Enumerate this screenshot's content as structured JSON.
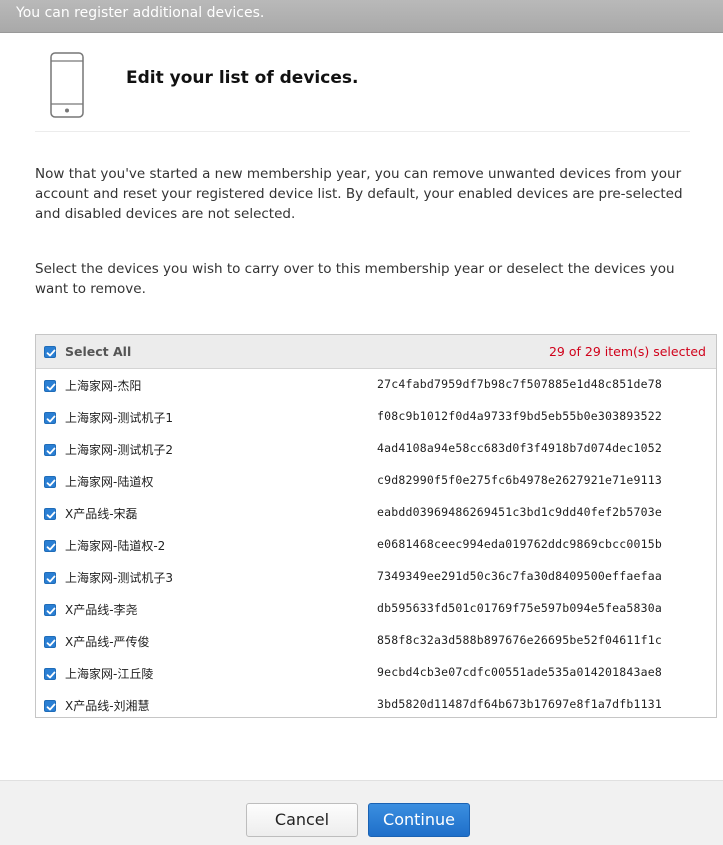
{
  "banner": {
    "text": "You can register additional devices."
  },
  "header": {
    "icon": "iphone-outline-icon",
    "title": "Edit your list of devices."
  },
  "intro": {
    "paragraph1": "Now that you've started a new membership year, you can remove unwanted devices from your account and reset your registered device list. By default, your enabled devices are pre-selected and disabled devices are not selected.",
    "paragraph2": "Select the devices you wish to carry over to this membership year or deselect the devices you want to remove."
  },
  "device_list": {
    "select_all_label": "Select All",
    "select_all_checked": true,
    "selection_count": "29 of 29 item(s) selected",
    "rows": [
      {
        "name": "上海家网-杰阳",
        "udid": "27c4fabd7959df7b98c7f507885e1d48c851de78",
        "checked": true
      },
      {
        "name": "上海家网-测试机子1",
        "udid": "f08c9b1012f0d4a9733f9bd5eb55b0e303893522",
        "checked": true
      },
      {
        "name": "上海家网-测试机子2",
        "udid": "4ad4108a94e58cc683d0f3f4918b7d074dec1052",
        "checked": true
      },
      {
        "name": "上海家网-陆道权",
        "udid": "c9d82990f5f0e275fc6b4978e2627921e71e9113",
        "checked": true
      },
      {
        "name": "X产品线-宋磊",
        "udid": "eabdd03969486269451c3bd1c9dd40fef2b5703e",
        "checked": true
      },
      {
        "name": "上海家网-陆道权-2",
        "udid": "e0681468ceec994eda019762ddc9869cbcc0015b",
        "checked": true
      },
      {
        "name": "上海家网-测试机子3",
        "udid": "7349349ee291d50c36c7fa30d8409500effaefaa",
        "checked": true
      },
      {
        "name": "X产品线-李尧",
        "udid": "db595633fd501c01769f75e597b094e5fea5830a",
        "checked": true
      },
      {
        "name": "X产品线-严传俊",
        "udid": "858f8c32a3d588b897676e26695be52f04611f1c",
        "checked": true
      },
      {
        "name": "上海家网-江丘陵",
        "udid": "9ecbd4cb3e07cdfc00551ade535a014201843ae8",
        "checked": true
      },
      {
        "name": "X产品线-刘湘慧",
        "udid": "3bd5820d11487df64b673b17697e8f1a7dfb1131",
        "checked": true
      }
    ]
  },
  "footer": {
    "cancel_label": "Cancel",
    "continue_label": "Continue"
  },
  "colors": {
    "accent": "#2a7fd4",
    "count_text": "#d0021b",
    "banner_bg": "#b0b0b0"
  }
}
